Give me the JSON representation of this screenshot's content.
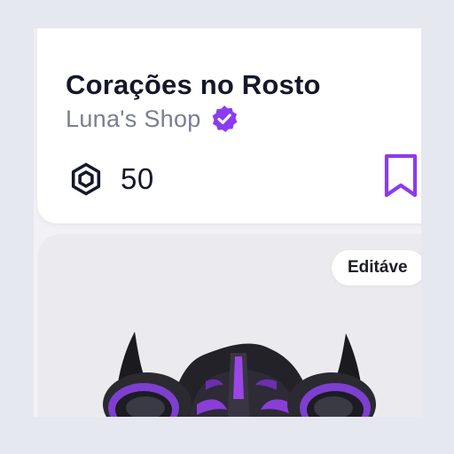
{
  "item": {
    "title": "Corações no Rosto",
    "shop_name": "Luna's Shop",
    "verified_icon": "verified-badge-icon",
    "currency_icon": "robux-icon",
    "price": "50",
    "bookmark_icon": "bookmark-icon"
  },
  "next_item": {
    "badge_label": "Editáve",
    "image": "purple-black-respirator-mask"
  },
  "colors": {
    "accent": "#8b3bf0",
    "title": "#15172a",
    "shop_name": "#7b7d92",
    "page_background": "#f2f2f6"
  }
}
